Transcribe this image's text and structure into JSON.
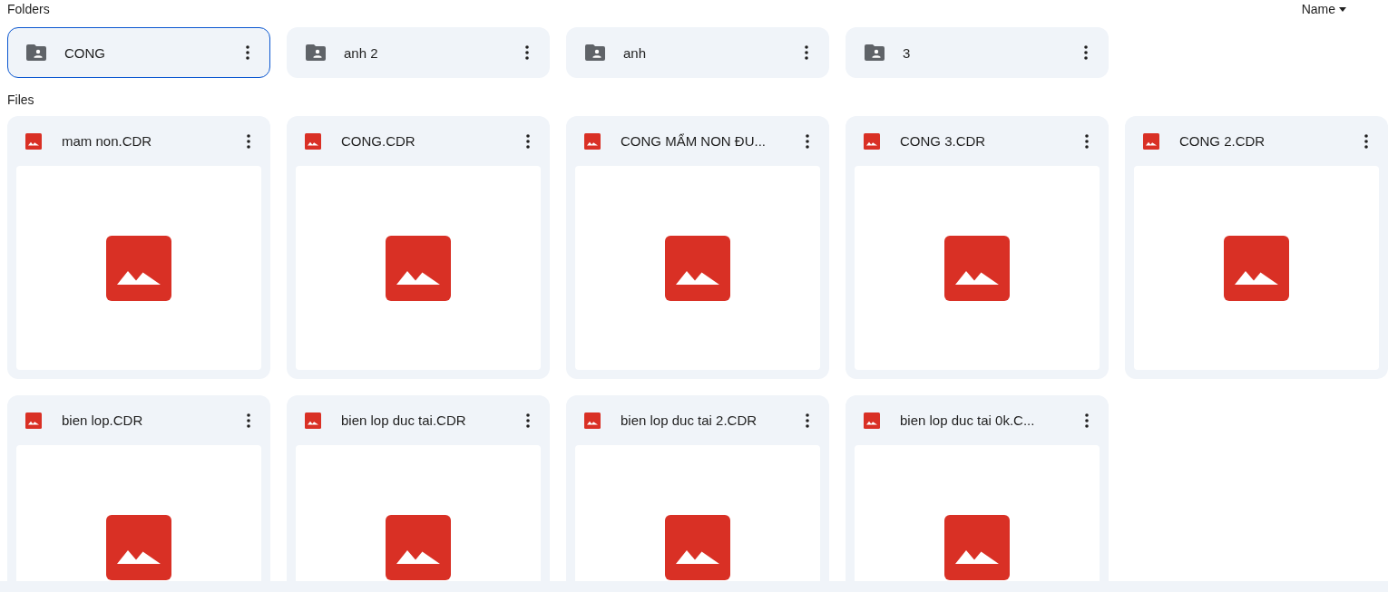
{
  "folders_section": {
    "title": "Folders",
    "sort": {
      "label": "Name"
    }
  },
  "folders": [
    {
      "name": "CONG",
      "selected": true
    },
    {
      "name": "anh 2",
      "selected": false
    },
    {
      "name": "anh",
      "selected": false
    },
    {
      "name": "3",
      "selected": false
    }
  ],
  "files_section": {
    "title": "Files"
  },
  "files": [
    {
      "name": "mam non.CDR"
    },
    {
      "name": "CONG.CDR"
    },
    {
      "name": "CONG MẨM NON ĐU..."
    },
    {
      "name": "CONG 3.CDR"
    },
    {
      "name": "CONG 2.CDR"
    },
    {
      "name": "bien lop.CDR"
    },
    {
      "name": "bien lop duc tai.CDR"
    },
    {
      "name": "bien lop duc tai 2.CDR"
    },
    {
      "name": "bien lop duc tai 0k.C..."
    }
  ]
}
